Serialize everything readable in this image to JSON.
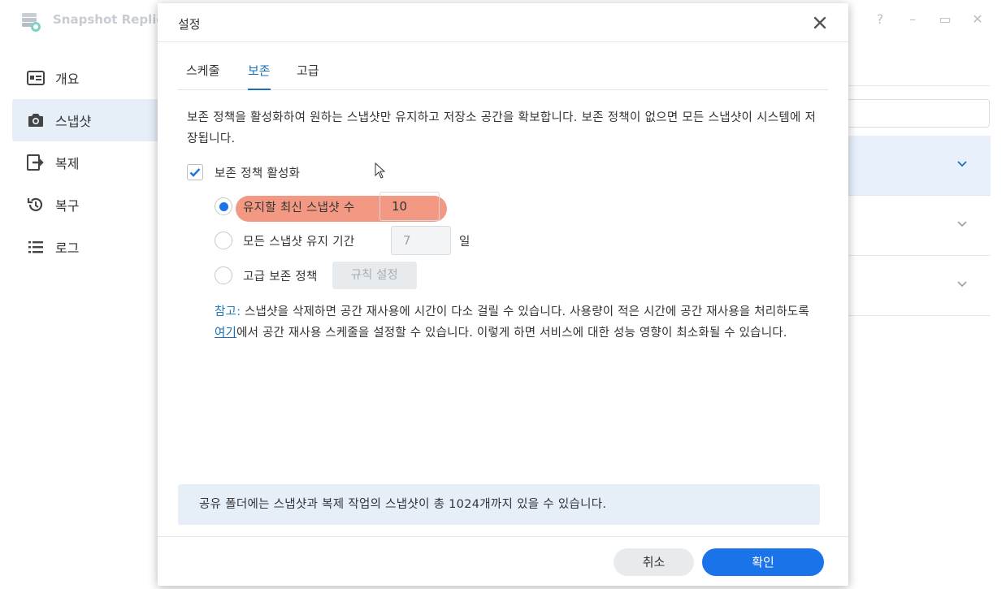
{
  "app": {
    "title": "Snapshot Replic",
    "window_controls": [
      "?",
      "–",
      "▭",
      "✕"
    ],
    "sidebar": [
      {
        "label": "개요",
        "icon": "overview-icon",
        "active": false
      },
      {
        "label": "스냅샷",
        "icon": "camera-icon",
        "active": true
      },
      {
        "label": "복제",
        "icon": "replication-icon",
        "active": false
      },
      {
        "label": "복구",
        "icon": "restore-icon",
        "active": false
      },
      {
        "label": "로그",
        "icon": "list-icon",
        "active": false
      }
    ]
  },
  "dialog": {
    "title": "설정",
    "tabs": [
      {
        "label": "스케줄",
        "active": false
      },
      {
        "label": "보존",
        "active": true
      },
      {
        "label": "고급",
        "active": false
      }
    ],
    "description": "보존 정책을 활성화하여 원하는 스냅샷만 유지하고 저장소 공간을 확보합니다. 보존 정책이 없으면 모든 스냅샷이 시스템에 저장됩니다.",
    "enable_label": "보존 정책 활성화",
    "enable_checked": true,
    "options": {
      "latest": {
        "label": "유지할 최신 스냅샷 수",
        "value": "10",
        "selected": true
      },
      "period": {
        "label": "모든 스냅샷 유지 기간",
        "value": "7",
        "unit": "일",
        "selected": false
      },
      "advanced": {
        "label": "고급 보존 정책",
        "button": "규칙 설정",
        "selected": false
      }
    },
    "note": {
      "prefix": "참고:",
      "text_before_link": " 스냅샷을 삭제하면 공간 재사용에 시간이 다소 걸릴 수 있습니다. 사용량이 적은 시간에 공간 재사용을 처리하도록 ",
      "link": "여기",
      "text_after_link": "에서 공간 재사용 스케줄을 설정할 수 있습니다. 이렇게 하면 서비스에 대한 성능 영향이 최소화될 수 있습니다."
    },
    "info": "공유 폴더에는 스냅샷과 복제 작업의 스냅샷이 총 1024개까지 있을 수 있습니다.",
    "buttons": {
      "cancel": "취소",
      "ok": "확인"
    },
    "colors": {
      "accent": "#1a73e8",
      "highlight": "#f07f64",
      "info_bg": "#e6eef8"
    }
  }
}
